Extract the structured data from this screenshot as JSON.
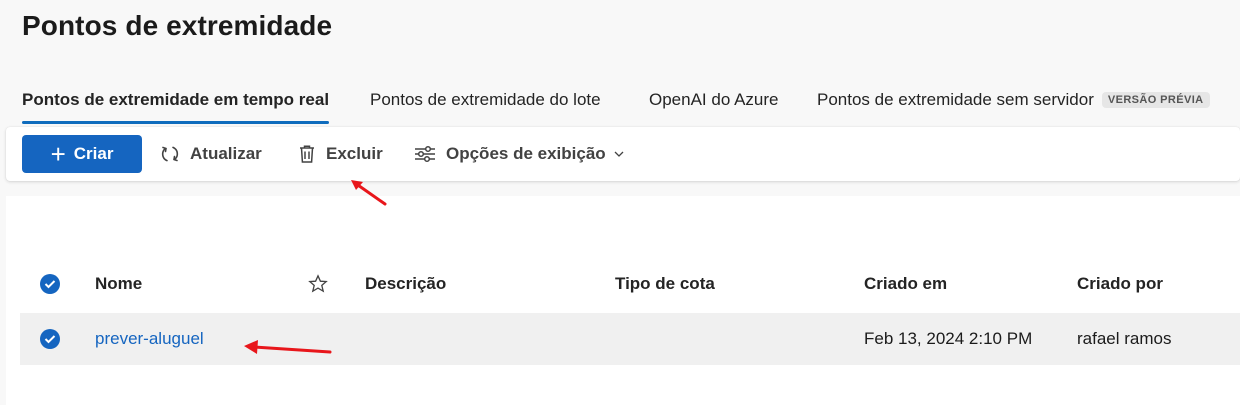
{
  "page": {
    "title": "Pontos de extremidade"
  },
  "tabs": [
    {
      "label": "Pontos de extremidade em tempo real",
      "active": true
    },
    {
      "label": "Pontos de extremidade do lote"
    },
    {
      "label": "OpenAI do Azure"
    },
    {
      "label": "Pontos de extremidade sem servidor",
      "badge": "VERSÃO PRÉVIA"
    }
  ],
  "toolbar": {
    "create_label": "Criar",
    "refresh_label": "Atualizar",
    "delete_label": "Excluir",
    "view_options_label": "Opções de exibição"
  },
  "table": {
    "columns": [
      "Nome",
      "Descrição",
      "Tipo de cota",
      "Criado em",
      "Criado por"
    ],
    "rows": [
      {
        "name": "prever-aluguel",
        "description": "",
        "quota_type": "",
        "created_on": "Feb 13, 2024 2:10 PM",
        "created_by": "rafael ramos",
        "selected": true
      }
    ]
  },
  "colors": {
    "accent": "#0f6cbd",
    "primary_button": "#1565c0",
    "annotation_arrow": "#e8161b"
  }
}
